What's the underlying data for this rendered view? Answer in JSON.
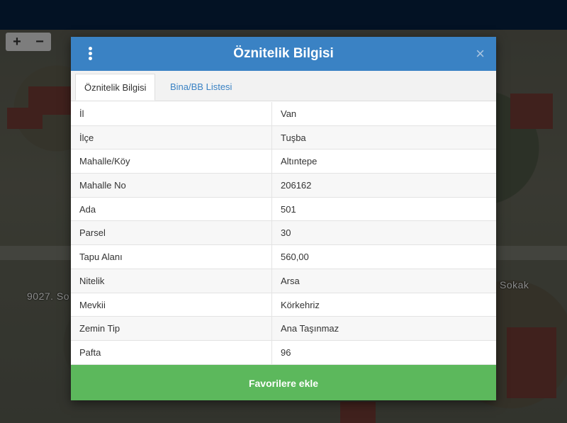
{
  "map": {
    "zoom_in": "+",
    "zoom_out": "−",
    "roads": [
      "9027. So",
      "Sokak"
    ]
  },
  "modal": {
    "title": "Öznitelik Bilgisi",
    "tabs": [
      {
        "label": "Öznitelik Bilgisi",
        "active": true
      },
      {
        "label": "Bina/BB Listesi",
        "active": false
      }
    ],
    "rows": [
      {
        "label": "İl",
        "value": "Van"
      },
      {
        "label": "İlçe",
        "value": "Tuşba"
      },
      {
        "label": "Mahalle/Köy",
        "value": "Altıntepe"
      },
      {
        "label": "Mahalle No",
        "value": "206162"
      },
      {
        "label": "Ada",
        "value": "501"
      },
      {
        "label": "Parsel",
        "value": "30"
      },
      {
        "label": "Tapu Alanı",
        "value": "560,00"
      },
      {
        "label": "Nitelik",
        "value": "Arsa"
      },
      {
        "label": "Mevkii",
        "value": "Körkehriz"
      },
      {
        "label": "Zemin Tip",
        "value": "Ana Taşınmaz"
      },
      {
        "label": "Pafta",
        "value": "96"
      }
    ],
    "favorite_button": "Favorilere ekle",
    "close": "×"
  },
  "colors": {
    "header": "#3a82c4",
    "favorite": "#5cb85c",
    "topbar": "#031224"
  }
}
